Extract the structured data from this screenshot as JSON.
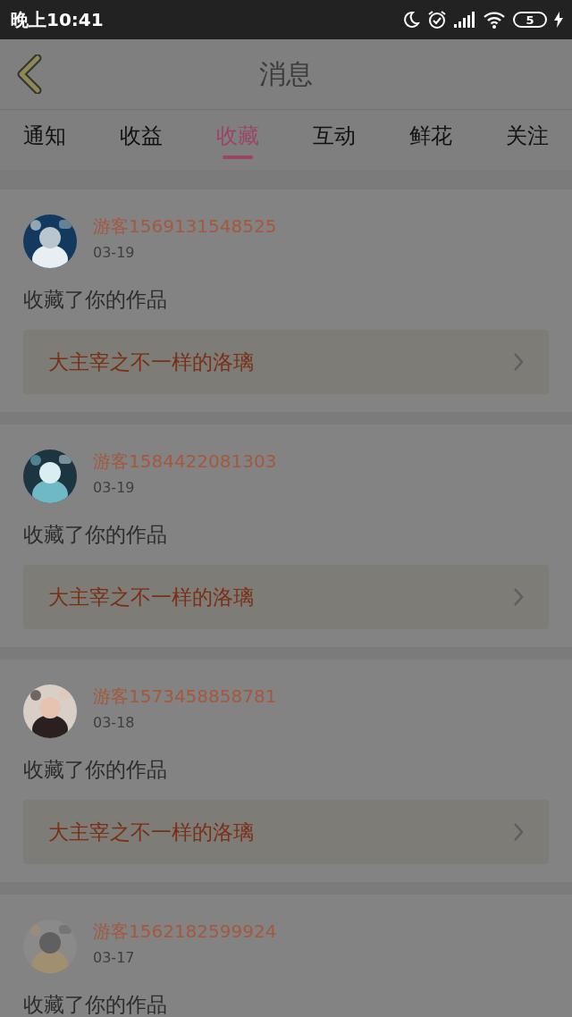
{
  "status_bar": {
    "time": "晚上10:41",
    "battery": "5"
  },
  "header": {
    "title": "消息"
  },
  "tabs": [
    {
      "label": "通知",
      "selected": false
    },
    {
      "label": "收益",
      "selected": false
    },
    {
      "label": "收藏",
      "selected": true
    },
    {
      "label": "互动",
      "selected": false
    },
    {
      "label": "鲜花",
      "selected": false
    },
    {
      "label": "关注",
      "selected": false
    }
  ],
  "messages": [
    {
      "user": "游客1569131548525",
      "date": "03-19",
      "text": "收藏了你的作品",
      "work": "大主宰之不一样的洛璃"
    },
    {
      "user": "游客1584422081303",
      "date": "03-19",
      "text": "收藏了你的作品",
      "work": "大主宰之不一样的洛璃"
    },
    {
      "user": "游客1573458858781",
      "date": "03-18",
      "text": "收藏了你的作品",
      "work": "大主宰之不一样的洛璃"
    },
    {
      "user": "游客1562182599924",
      "date": "03-17",
      "text": "收藏了你的作品"
    }
  ]
}
